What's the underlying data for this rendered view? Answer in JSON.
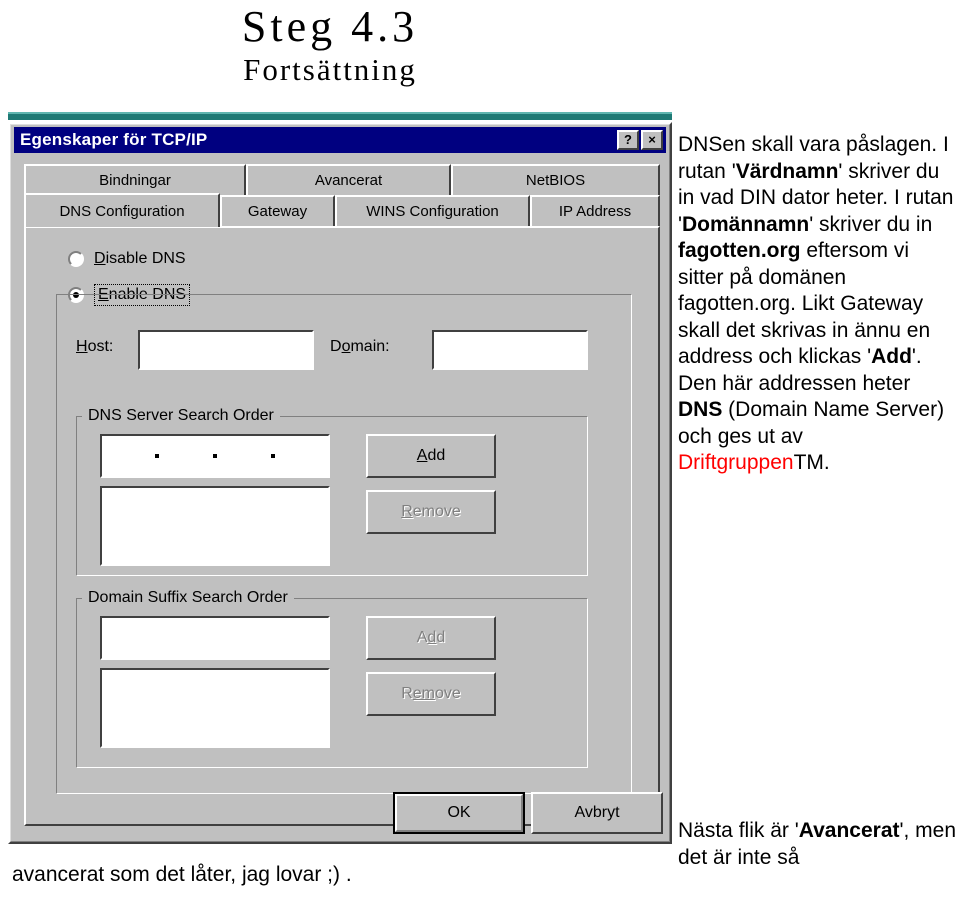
{
  "slide": {
    "title_main": "Steg 4.3",
    "title_sub": "Fortsättning"
  },
  "dialog": {
    "title": "Egenskaper för TCP/IP",
    "help_button": "?",
    "close_button": "×",
    "tabs_top": [
      {
        "label": "Bindningar"
      },
      {
        "label": "Avancerat"
      },
      {
        "label": "NetBIOS"
      }
    ],
    "tabs_bottom": [
      {
        "label": "DNS Configuration",
        "active": true
      },
      {
        "label": "Gateway",
        "active": false
      },
      {
        "label": "WINS Configuration",
        "active": false
      },
      {
        "label": "IP Address",
        "active": false
      }
    ],
    "radios": {
      "disable_dns": "Disable DNS",
      "enable_dns": "Enable DNS"
    },
    "host_label": "Host:",
    "host_value": "",
    "domain_label": "Domain:",
    "domain_value": "",
    "dns_group": {
      "title": "DNS Server Search Order",
      "ip_value": "",
      "list_value": "",
      "add_label": "Add",
      "remove_label": "Remove"
    },
    "suffix_group": {
      "title": "Domain Suffix Search Order",
      "input_value": "",
      "list_value": "",
      "add_label": "Add",
      "remove_label": "Remove"
    },
    "ok_label": "OK",
    "cancel_label": "Avbryt"
  },
  "body_text": {
    "p1_a": "DNSen skall vara påslagen. I rutan '",
    "p1_b": "Värdnamn",
    "p1_c": "' skriver du in vad DIN dator heter. I rutan '",
    "p1_d": "Domännamn",
    "p1_e": "' skriver du in ",
    "p1_f": "fagotten.org",
    "p1_g": " eftersom vi sitter på domänen fagotten.org. Likt Gateway skall det skrivas in ännu en address och klickas '",
    "p1_h": "Add",
    "p1_i": "'. Den här addressen heter ",
    "p1_j": "DNS",
    "p1_k": " (Domain Name Server) och ges ut av ",
    "p1_l": "Driftgruppen",
    "p1_m": "TM."
  },
  "footnote": {
    "right_a": "Nästa flik är '",
    "right_b": "Avancerat",
    "right_c": "', men det är inte så",
    "left": "avancerat som det låter, jag lovar ;) ."
  },
  "colors": {
    "accent_teal": "#1f7a75",
    "titlebar_blue": "#000080",
    "dialog_face": "#c0c0c0",
    "brand_red": "#ff0000"
  }
}
